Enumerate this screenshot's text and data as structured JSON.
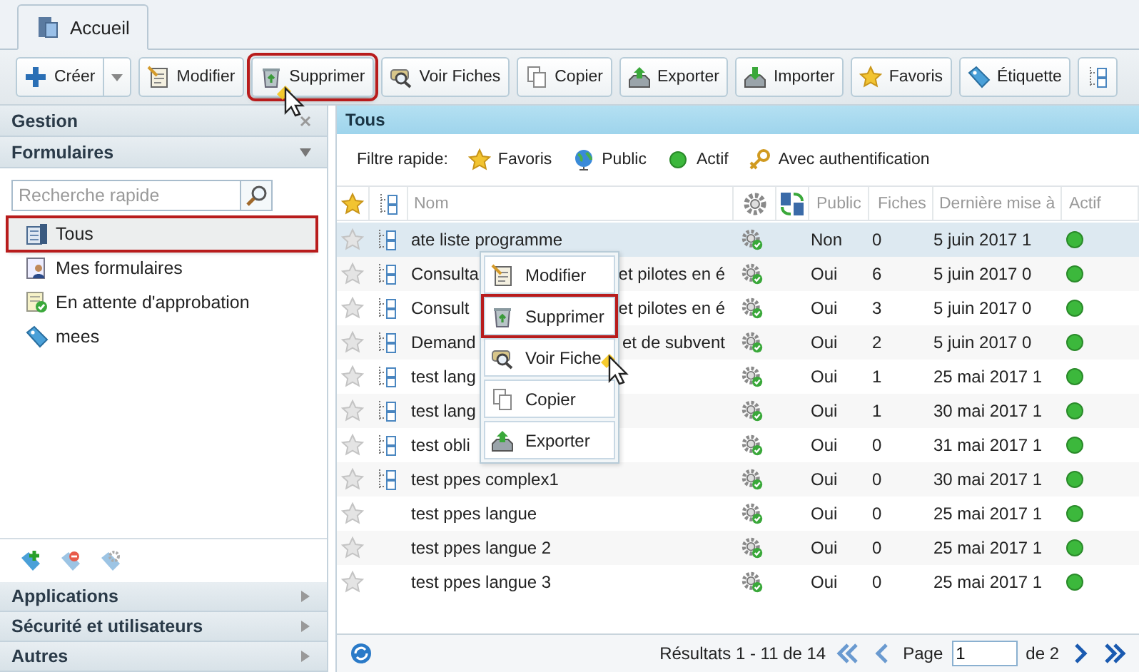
{
  "tabs": [
    {
      "label": "Accueil",
      "selected": true
    }
  ],
  "toolbar": [
    {
      "label": "Créer",
      "dropdown": true,
      "highlighted": false
    },
    {
      "label": "Modifier",
      "dropdown": false,
      "highlighted": false
    },
    {
      "label": "Supprimer",
      "dropdown": false,
      "highlighted": true
    },
    {
      "label": "Voir Fiches",
      "dropdown": false,
      "highlighted": false
    },
    {
      "label": "Copier",
      "dropdown": false,
      "highlighted": false
    },
    {
      "label": "Exporter",
      "dropdown": false,
      "highlighted": false
    },
    {
      "label": "Importer",
      "dropdown": false,
      "highlighted": false
    },
    {
      "label": "Favoris",
      "dropdown": false,
      "highlighted": false
    },
    {
      "label": "Étiquette",
      "dropdown": false,
      "highlighted": false
    },
    {
      "dropdown": false,
      "highlighted": false
    }
  ],
  "sidebar": {
    "sections": [
      {
        "title": "Gestion"
      },
      {
        "title": "Formulaires",
        "expanded": true
      }
    ],
    "search": {
      "placeholder": "Recherche rapide"
    },
    "items": [
      {
        "label": "Tous",
        "selected": true
      },
      {
        "label": "Mes formulaires",
        "selected": false
      },
      {
        "label": "En attente d'approbation",
        "selected": false
      },
      {
        "label": "mees",
        "selected": false
      }
    ],
    "bottom_sections": [
      {
        "title": "Applications",
        "expanded": false
      },
      {
        "title": "Sécurité et utilisateurs",
        "expanded": false
      },
      {
        "title": "Autres",
        "expanded": false
      }
    ]
  },
  "main": {
    "title": "Tous",
    "filter": {
      "label": "Filtre rapide:",
      "options": [
        "Favoris",
        "Public",
        "Actif",
        "Avec authentification"
      ]
    },
    "columns": [
      "Nom",
      "Public",
      "Fiches",
      "Dernière mise à",
      "Actif"
    ],
    "rows": [
      {
        "name": "ate liste programme",
        "public": "Non",
        "fiches": "0",
        "date": "5 juin 2017 1",
        "favorite": false,
        "linked": true,
        "active": true,
        "selected": true
      },
      {
        "name": "Consulta",
        "name_end": "et pilotes en é",
        "public": "Oui",
        "fiches": "6",
        "date": "5 juin 2017 0",
        "favorite": false,
        "linked": true,
        "active": true,
        "selected": false
      },
      {
        "name": "Consult",
        "name_end": "et pilotes en é",
        "public": "Oui",
        "fiches": "3",
        "date": "5 juin 2017 0",
        "favorite": false,
        "linked": true,
        "active": true,
        "selected": false
      },
      {
        "name": "Demand",
        "name_end": "et de subvent",
        "public": "Oui",
        "fiches": "2",
        "date": "5 juin 2017 0",
        "favorite": false,
        "linked": true,
        "active": true,
        "selected": false
      },
      {
        "name": "test lang",
        "public": "Oui",
        "fiches": "1",
        "date": "25 mai 2017 1",
        "favorite": false,
        "linked": true,
        "active": true,
        "selected": false
      },
      {
        "name": "test lang",
        "public": "Oui",
        "fiches": "1",
        "date": "30 mai 2017 1",
        "favorite": false,
        "linked": true,
        "active": true,
        "selected": false
      },
      {
        "name": "test obli",
        "public": "Oui",
        "fiches": "0",
        "date": "31 mai 2017 1",
        "favorite": false,
        "linked": true,
        "active": true,
        "selected": false
      },
      {
        "name": "test ppes complex1",
        "public": "Oui",
        "fiches": "0",
        "date": "30 mai 2017 1",
        "favorite": false,
        "linked": true,
        "active": true,
        "selected": false
      },
      {
        "name": "test ppes langue",
        "public": "Oui",
        "fiches": "0",
        "date": "25 mai 2017 1",
        "favorite": false,
        "linked": false,
        "active": true,
        "selected": false
      },
      {
        "name": "test ppes langue 2",
        "public": "Oui",
        "fiches": "0",
        "date": "25 mai 2017 1",
        "favorite": false,
        "linked": false,
        "active": true,
        "selected": false
      },
      {
        "name": "test ppes langue 3",
        "public": "Oui",
        "fiches": "0",
        "date": "25 mai 2017 1",
        "favorite": false,
        "linked": false,
        "active": true,
        "selected": false
      }
    ],
    "context_menu": [
      {
        "label": "Modifier",
        "selected": false
      },
      {
        "label": "Supprimer",
        "selected": true
      },
      {
        "label": "Voir Fiche",
        "selected": false
      },
      {
        "label": "Copier",
        "selected": false
      },
      {
        "label": "Exporter",
        "selected": false
      }
    ],
    "pager": {
      "results": "Résultats 1 - 11 de 14",
      "page_label": "Page",
      "page": "1",
      "of": "de 2"
    }
  }
}
